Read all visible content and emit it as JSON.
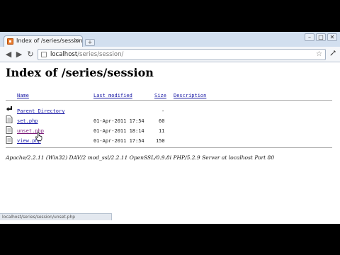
{
  "browser": {
    "tab_title": "Index of /series/session",
    "tab_close": "×",
    "new_tab": "+",
    "window_controls": {
      "minimize": "–",
      "maximize": "□",
      "close": "✕"
    },
    "address": {
      "host": "localhost",
      "path": "/series/session/"
    },
    "nav": {
      "back": "◀",
      "forward": "▶",
      "reload": "↻"
    },
    "star": "☆",
    "wrench": "🔧",
    "status_text": "localhost/series/session/unset.php"
  },
  "page": {
    "title": "Index of /series/session",
    "columns": {
      "name": "Name",
      "modified": "Last modified",
      "size": "Size",
      "description": "Description"
    },
    "parent": {
      "name": "Parent Directory",
      "size": "-"
    },
    "files": [
      {
        "name": "set.php",
        "modified": "01-Apr-2011 17:54",
        "size": "60"
      },
      {
        "name": "unset.php",
        "modified": "01-Apr-2011 18:14",
        "size": "11"
      },
      {
        "name": "view.php",
        "modified": "01-Apr-2011 17:54",
        "size": "150"
      }
    ],
    "footer": "Apache/2.2.11 (Win32) DAV/2 mod_ssl/2.2.11 OpenSSL/0.9.8i PHP/5.2.9 Server at localhost Port 80"
  }
}
